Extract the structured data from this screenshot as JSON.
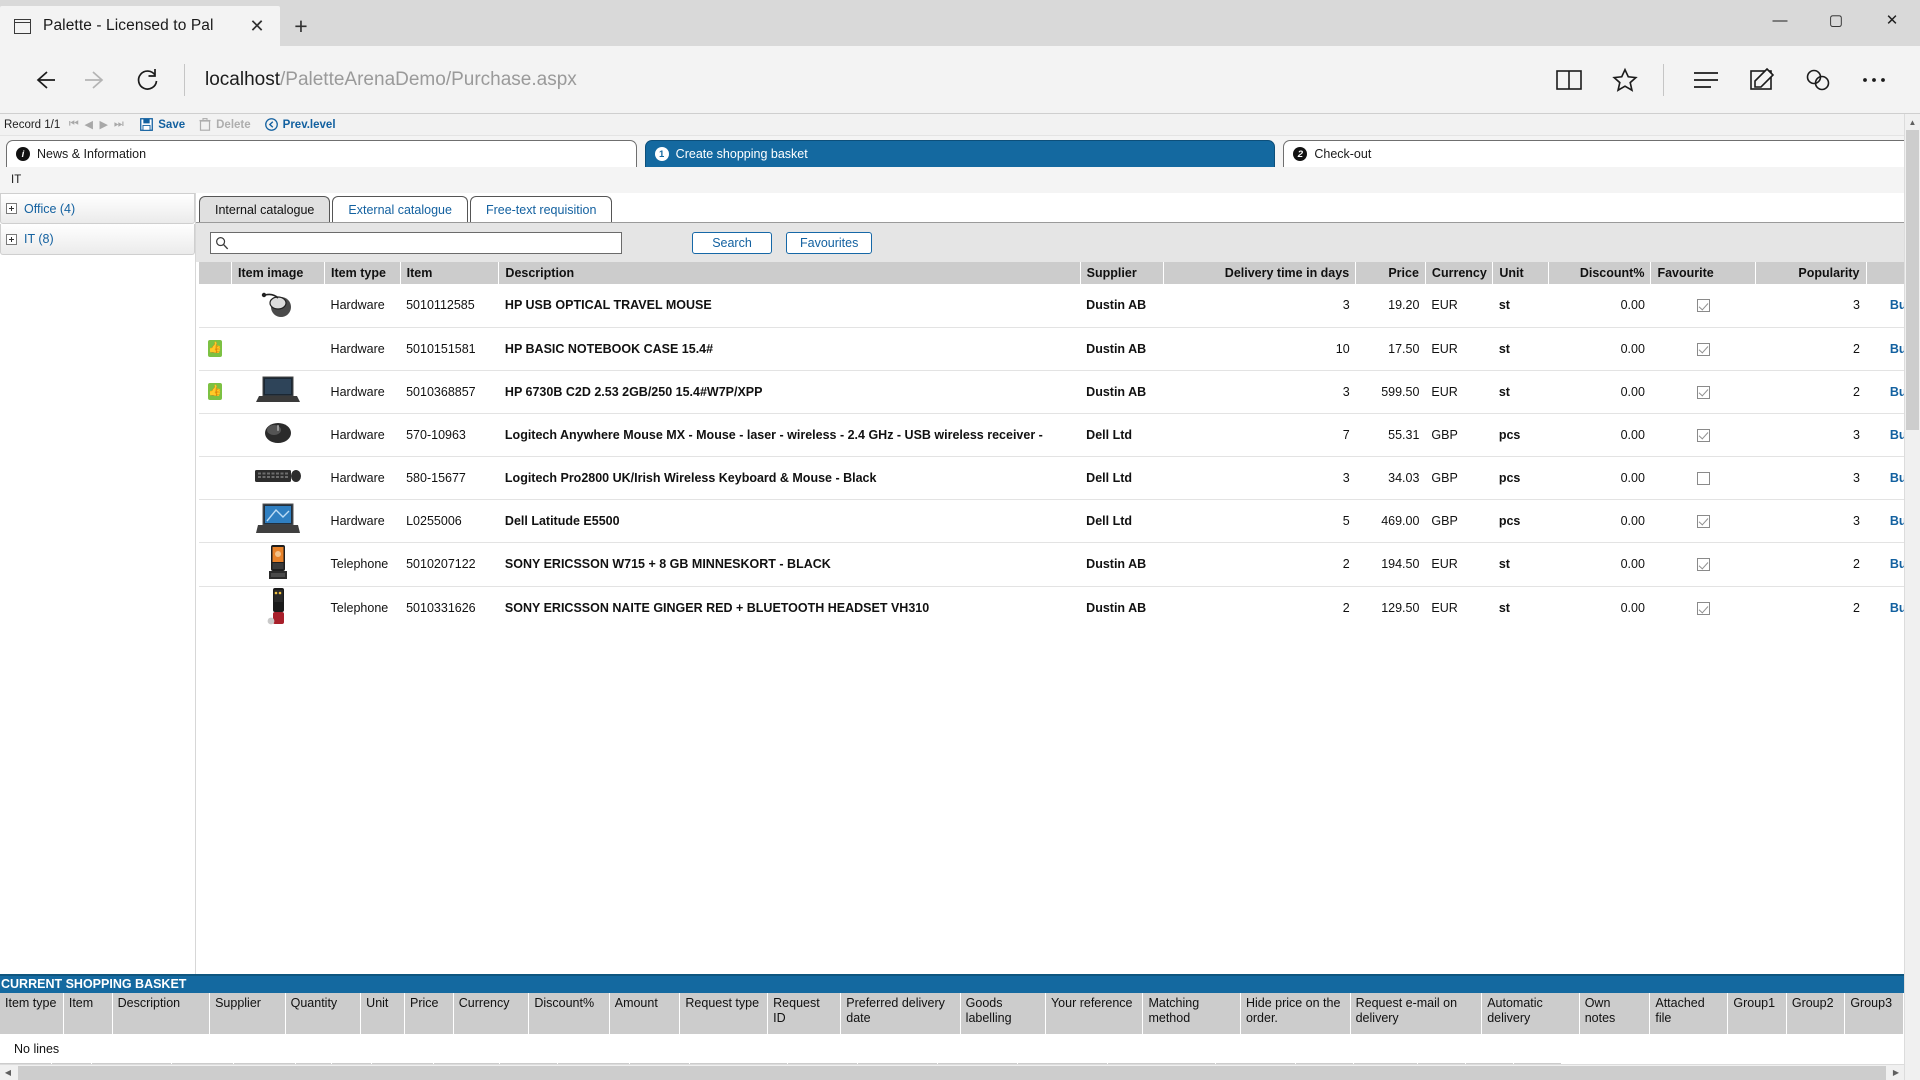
{
  "browser": {
    "tab_title": "Palette - Licensed to Pal",
    "tab_close": "✕",
    "new_tab": "+",
    "url_host": "localhost",
    "url_path": "/PaletteArenaDemo/Purchase.aspx",
    "minimize": "—",
    "maximize": "▢",
    "close": "✕"
  },
  "toolbar": {
    "record_label": "Record 1/1",
    "nav_first": "⏮",
    "nav_prev": "◀",
    "nav_next": "▶",
    "nav_last": "⏭",
    "save_label": "Save",
    "delete_label": "Delete",
    "prev_level_label": "Prev.level"
  },
  "steps": [
    {
      "badge": "i",
      "label": "News & Information",
      "active": false
    },
    {
      "badge": "1",
      "label": "Create shopping basket",
      "active": true
    },
    {
      "badge": "2",
      "label": "Check-out",
      "active": false
    }
  ],
  "breadcrumb": "IT",
  "sidebar": {
    "items": [
      {
        "label": "Office (4)"
      },
      {
        "label": "IT (8)"
      }
    ]
  },
  "catalogue_tabs": [
    {
      "label": "Internal catalogue",
      "active": true
    },
    {
      "label": "External catalogue",
      "active": false
    },
    {
      "label": "Free-text requisition",
      "active": false
    }
  ],
  "search": {
    "value": "",
    "placeholder": "",
    "search_button": "Search",
    "favourites_button": "Favourites"
  },
  "catalogue_table": {
    "columns": [
      "",
      "Item image",
      "Item type",
      "Item",
      "Description",
      "Supplier",
      "Delivery time in days",
      "Price",
      "Currency",
      "Unit",
      "Discount%",
      "Favourite",
      "Popularity",
      ""
    ],
    "rows": [
      {
        "flag": false,
        "image": "mouse",
        "item_type": "Hardware",
        "item": "5010112585",
        "description": "HP USB OPTICAL TRAVEL MOUSE",
        "supplier": "Dustin AB",
        "delivery": "3",
        "price": "19.20",
        "currency": "EUR",
        "unit": "st",
        "discount": "0.00",
        "favourite": true,
        "popularity": "3",
        "buy": "Buy"
      },
      {
        "flag": true,
        "image": "none",
        "item_type": "Hardware",
        "item": "5010151581",
        "description": "HP BASIC NOTEBOOK CASE 15.4#",
        "supplier": "Dustin AB",
        "delivery": "10",
        "price": "17.50",
        "currency": "EUR",
        "unit": "st",
        "discount": "0.00",
        "favourite": true,
        "popularity": "2",
        "buy": "Buy"
      },
      {
        "flag": true,
        "image": "laptop-dark",
        "item_type": "Hardware",
        "item": "5010368857",
        "description": "HP 6730B C2D 2.53 2GB/250 15.4#W7P/XPP",
        "supplier": "Dustin AB",
        "delivery": "3",
        "price": "599.50",
        "currency": "EUR",
        "unit": "st",
        "discount": "0.00",
        "favourite": true,
        "popularity": "2",
        "buy": "Buy"
      },
      {
        "flag": false,
        "image": "mouse-black",
        "item_type": "Hardware",
        "item": "570-10963",
        "description": "Logitech Anywhere Mouse MX - Mouse - laser - wireless - 2.4 GHz - USB wireless receiver -",
        "supplier": "Dell Ltd",
        "delivery": "7",
        "price": "55.31",
        "currency": "GBP",
        "unit": "pcs",
        "discount": "0.00",
        "favourite": true,
        "popularity": "3",
        "buy": "Buy"
      },
      {
        "flag": false,
        "image": "keyboard",
        "item_type": "Hardware",
        "item": "580-15677",
        "description": "Logitech Pro2800 UK/Irish Wireless Keyboard & Mouse - Black",
        "supplier": "Dell Ltd",
        "delivery": "3",
        "price": "34.03",
        "currency": "GBP",
        "unit": "pcs",
        "discount": "0.00",
        "favourite": false,
        "popularity": "3",
        "buy": "Buy"
      },
      {
        "flag": false,
        "image": "laptop-blue",
        "item_type": "Hardware",
        "item": "L0255006",
        "description": "Dell Latitude E5500",
        "supplier": "Dell Ltd",
        "delivery": "5",
        "price": "469.00",
        "currency": "GBP",
        "unit": "pcs",
        "discount": "0.00",
        "favourite": true,
        "popularity": "3",
        "buy": "Buy"
      },
      {
        "flag": false,
        "image": "phone-orange",
        "item_type": "Telephone",
        "item": "5010207122",
        "description": "SONY ERICSSON W715 + 8 GB MINNESKORT - BLACK",
        "supplier": "Dustin AB",
        "delivery": "2",
        "price": "194.50",
        "currency": "EUR",
        "unit": "st",
        "discount": "0.00",
        "favourite": true,
        "popularity": "2",
        "buy": "Buy"
      },
      {
        "flag": false,
        "image": "phone-red",
        "item_type": "Telephone",
        "item": "5010331626",
        "description": "SONY ERICSSON NAITE GINGER RED + BLUETOOTH HEADSET VH310",
        "supplier": "Dustin AB",
        "delivery": "2",
        "price": "129.50",
        "currency": "EUR",
        "unit": "st",
        "discount": "0.00",
        "favourite": true,
        "popularity": "2",
        "buy": "Buy"
      }
    ]
  },
  "basket": {
    "title": "CURRENT SHOPPING BASKET",
    "columns": [
      "Item type",
      "Item",
      "Description",
      "Supplier",
      "Quantity",
      "Unit",
      "Price",
      "Currency",
      "Discount%",
      "Amount",
      "Request type",
      "Request ID",
      "Preferred delivery date",
      "Goods labelling",
      "Your reference",
      "Matching method",
      "Hide price on the order.",
      "Request e-mail on delivery",
      "Automatic delivery",
      "Own notes",
      "Attached file",
      "Group1",
      "Group2",
      "Group3"
    ],
    "empty_text": "No lines"
  },
  "colors": {
    "accent": "#1469a0",
    "link": "#1361a0",
    "header_bg": "#cccccc",
    "flag_green": "#7cc143"
  }
}
